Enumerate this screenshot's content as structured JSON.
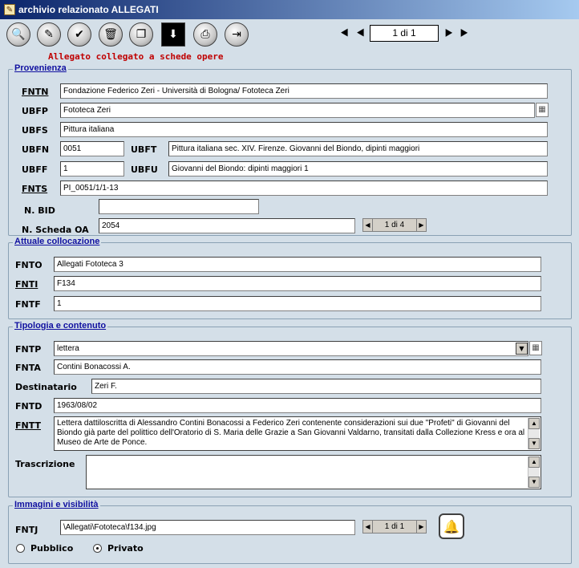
{
  "window": {
    "title": "archivio relazionato ALLEGATI",
    "icon": "pencil-icon"
  },
  "toolbar": {
    "buttons": [
      {
        "name": "search-icon",
        "glyph": "🔍"
      },
      {
        "name": "edit-icon",
        "glyph": "✎"
      },
      {
        "name": "approve-icon",
        "glyph": "✔"
      },
      {
        "name": "delete-icon",
        "glyph": "🗑"
      },
      {
        "name": "copy-icon",
        "glyph": "❐"
      },
      {
        "name": "download-icon",
        "glyph": "⬇"
      },
      {
        "name": "print-icon",
        "glyph": "⎙"
      },
      {
        "name": "exit-icon",
        "glyph": "⇥"
      }
    ],
    "record_counter": "1 di 1"
  },
  "subtitle": "Allegato collegato a schede opere",
  "provenienza": {
    "title": "Provenienza",
    "fntn_label": "FNTN",
    "fntn": "Fondazione Federico Zeri - Università di Bologna/ Fototeca Zeri",
    "ubfp_label": "UBFP",
    "ubfp": "Fototeca  Zeri",
    "ubfs_label": "UBFS",
    "ubfs": "Pittura italiana",
    "ubfn_label": "UBFN",
    "ubfn": "0051",
    "ubft_label": "UBFT",
    "ubft": "Pittura italiana sec. XIV. Firenze. Giovanni del Biondo, dipinti maggiori",
    "ubff_label": "UBFF",
    "ubff": "1",
    "ubfu_label": "UBFU",
    "ubfu": "Giovanni del Biondo: dipinti maggiori 1",
    "fnts_label": "FNTS",
    "fnts": "PI_0051/1/1-13",
    "nbid_label": "N. BID",
    "nbid": "",
    "nscheda_label": "N. Scheda OA",
    "nscheda": "2054",
    "pager": "1 di 4"
  },
  "collocazione": {
    "title": "Attuale collocazione",
    "fnto_label": "FNTO",
    "fnto": "Allegati Fototeca 3",
    "fnti_label": "FNTI",
    "fnti": "F134",
    "fntf_label": "FNTF",
    "fntf": "1"
  },
  "tipologia": {
    "title": "Tipologia e contenuto",
    "fntp_label": "FNTP",
    "fntp": "lettera",
    "fnta_label": "FNTA",
    "fnta": "Contini Bonacossi A.",
    "dest_label": "Destinatario",
    "dest": "Zeri F.",
    "fntd_label": "FNTD",
    "fntd": "1963/08/02",
    "fntt_label": "FNTT",
    "fntt": "Lettera dattiloscritta di Alessandro Contini Bonacossi a Federico Zeri contenente considerazioni sui due \"Profeti\" di Giovanni del Biondo già parte del polittico dell'Oratorio di S. Maria delle Grazie a San Giovanni Valdarno, transitati dalla Collezione Kress e ora al Museo de Arte de Ponce.",
    "trascr_label": "Trascrizione",
    "trascr": ""
  },
  "immagini": {
    "title": "Immagini e visibilità",
    "fntj_label": "FNTJ",
    "fntj": "\\Allegati\\Fototeca\\f134.jpg",
    "pager": "1 di 1",
    "pubblico": "Pubblico",
    "privato": "Privato"
  }
}
